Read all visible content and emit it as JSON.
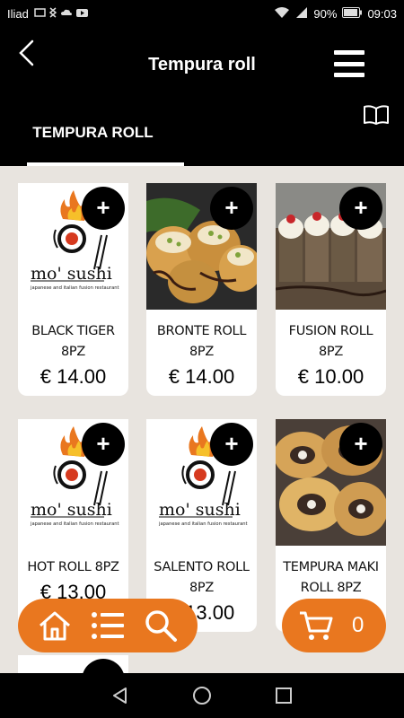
{
  "status_bar": {
    "carrier": "Iliad",
    "battery": "90%",
    "time": "09:03"
  },
  "header": {
    "title": "Tempura roll",
    "tab_label": "TEMPURA ROLL"
  },
  "colors": {
    "accent": "#e9771f",
    "header_bg": "#000000",
    "page_bg": "#e8e4df"
  },
  "logo": {
    "brand": "mo' sushi",
    "tagline": "japanese and italian fusion restaurant"
  },
  "products": [
    {
      "name": "BLACK TIGER 8PZ",
      "price": "€ 14.00",
      "image": "logo"
    },
    {
      "name": "BRONTE ROLL 8PZ",
      "price": "€ 14.00",
      "image": "photo-bronte"
    },
    {
      "name": "FUSION ROLL 8PZ",
      "price": "€ 10.00",
      "image": "photo-fusion"
    },
    {
      "name": "HOT ROLL 8PZ",
      "price": "€ 13.00",
      "image": "logo"
    },
    {
      "name": "SALENTO ROLL 8PZ",
      "price": "€ 13.00",
      "image": "logo"
    },
    {
      "name": "TEMPURA MAKI ROLL 8PZ",
      "price": "",
      "image": "photo-tempura"
    }
  ],
  "add_label": "+",
  "cart": {
    "count": "0"
  },
  "icons": {
    "back": "chevron-left-icon",
    "menu": "hamburger-icon",
    "book": "book-icon",
    "home": "home-icon",
    "list": "list-icon",
    "search": "search-icon",
    "cart": "cart-icon"
  }
}
